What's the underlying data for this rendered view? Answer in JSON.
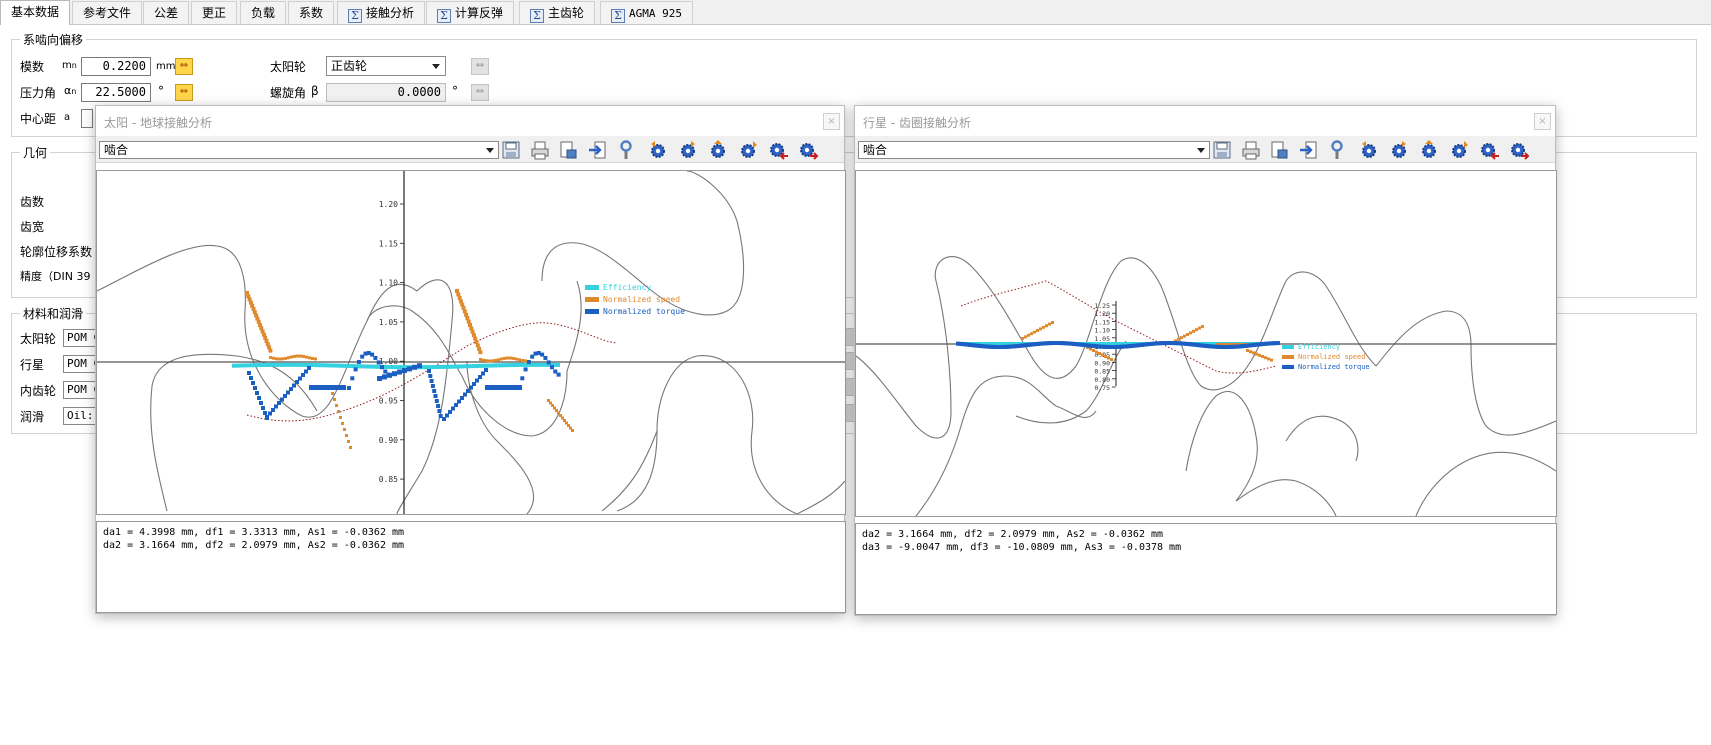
{
  "tabs": [
    {
      "label": "基本数据",
      "sigma": false
    },
    {
      "label": "参考文件",
      "sigma": false
    },
    {
      "label": "公差",
      "sigma": false
    },
    {
      "label": "更正",
      "sigma": false
    },
    {
      "label": "负载",
      "sigma": false
    },
    {
      "label": "系数",
      "sigma": false
    },
    {
      "label": "接触分析",
      "sigma": true
    },
    {
      "label": "计算反弹",
      "sigma": true
    },
    {
      "label": "主齿轮",
      "sigma": true
    },
    {
      "label": "AGMA 925",
      "sigma": true
    }
  ],
  "basic": {
    "group_title": "系啮向偏移",
    "module_label": "模数",
    "module_sym": "m",
    "module_sub": "n",
    "module_value": "0.2200",
    "module_unit": "mm",
    "pressure_label": "压力角",
    "pressure_sym": "α",
    "pressure_sub": "n",
    "pressure_value": "22.5000",
    "pressure_unit": "°",
    "center_label": "中心距",
    "center_sym": "a",
    "sun_label": "太阳轮",
    "sun_value": "正齿轮",
    "helix_label": "螺旋角",
    "helix_sym": "β",
    "helix_value": "0.0000",
    "helix_unit": "°"
  },
  "geometry": {
    "group_title": "几何",
    "teeth_label": "齿数",
    "width_label": "齿宽",
    "shift_label": "轮廓位移系数",
    "precision_label": "精度（DIN 39"
  },
  "materials": {
    "group_title": "材料和润滑",
    "rows": [
      {
        "label": "太阳轮",
        "value": "POM C"
      },
      {
        "label": "行星",
        "value": "POM C"
      },
      {
        "label": "内齿轮",
        "value": "POM C"
      },
      {
        "label": "润滑",
        "value": "Oil: I"
      }
    ]
  },
  "window_left": {
    "title": "太阳 - 地球接触分析",
    "view": "啮合",
    "legend": [
      "Efficiency",
      "Normalized speed",
      "Normalized torque"
    ],
    "ticks": [
      "1.20",
      "1.15",
      "1.10",
      "1.05",
      "1.00",
      "0.95",
      "0.90",
      "0.85"
    ],
    "info": [
      "da1 = 4.3998 mm, df1 = 3.3313 mm, As1 = -0.0362 mm",
      "da2 = 3.1664 mm, df2 = 2.0979 mm, As2 = -0.0362 mm"
    ]
  },
  "window_right": {
    "title": "行星 - 齿圈接触分析",
    "view": "啮合",
    "legend": [
      "Efficiency",
      "Normalized speed",
      "Normalized torque"
    ],
    "ticks": [
      "1.25",
      "1.20",
      "1.15",
      "1.10",
      "1.05",
      "1.00",
      "0.95",
      "0.90",
      "0.85",
      "0.80",
      "0.75"
    ],
    "info": [
      "da2 = 3.1664 mm, df2 = 2.0979 mm, As2 = -0.0362 mm",
      "da3 = -9.0047 mm, df3 = -10.0809 mm, As3 = -0.0378 mm"
    ]
  },
  "colors": {
    "efficiency": "#34d1e0",
    "speed": "#e08a2e",
    "torque": "#1b5fc2",
    "gear_outline": "#777777",
    "path": "#8b1a1a"
  },
  "icons": {
    "close": "×",
    "arrow_btn": "⇔"
  }
}
